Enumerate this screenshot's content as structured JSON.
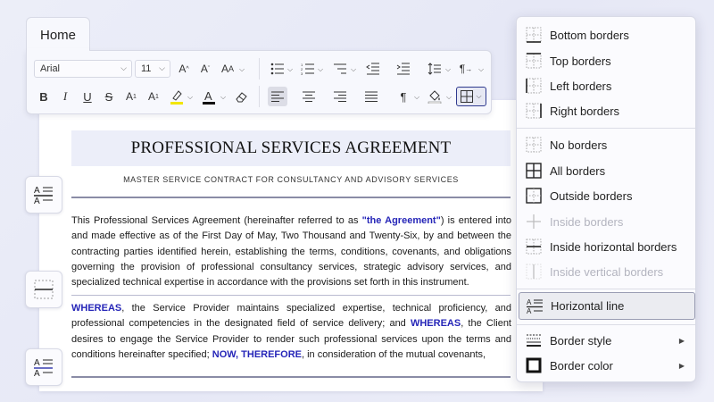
{
  "ribbon": {
    "tab_label": "Home",
    "font_family": "Arial",
    "font_size": "11"
  },
  "document": {
    "title": "PROFESSIONAL SERVICES AGREEMENT",
    "subtitle": "MASTER SERVICE CONTRACT FOR CONSULTANCY AND ADVISORY SERVICES",
    "para1": {
      "t1": "This Professional Services Agreement (hereinafter referred to as ",
      "t2": "\"the Agreement\"",
      "t3": ") is entered into and made effective as of the First Day of May, Two Thousand and Twenty-Six, by and between the contracting parties identified herein, establishing the terms, conditions, covenants, and obligations governing the provision of professional consultancy services, strategic advisory services, and specialized technical expertise in accordance with the provisions set forth in this instrument."
    },
    "para2": {
      "kw1": "WHEREAS",
      "t1": ", the Service Provider maintains specialized expertise, technical proficiency, and professional competencies in the designated field of service delivery; and ",
      "kw2": "WHEREAS",
      "t2": ", the Client desires to engage the Service Provider to render such professional services upon the terms and conditions hereinafter specified; ",
      "kw3": "NOW, THEREFORE",
      "t3": ", in consideration of the mutual covenants,"
    }
  },
  "border_menu": {
    "items": [
      {
        "label": "Bottom borders",
        "icon": "border-bottom-icon"
      },
      {
        "label": "Top borders",
        "icon": "border-top-icon"
      },
      {
        "label": "Left borders",
        "icon": "border-left-icon"
      },
      {
        "label": "Right borders",
        "icon": "border-right-icon"
      },
      {
        "label": "No borders",
        "icon": "border-none-icon"
      },
      {
        "label": "All borders",
        "icon": "border-all-icon"
      },
      {
        "label": "Outside borders",
        "icon": "border-outside-icon"
      },
      {
        "label": "Inside borders",
        "icon": "border-inside-icon",
        "disabled": true
      },
      {
        "label": "Inside horizontal borders",
        "icon": "border-inside-horizontal-icon"
      },
      {
        "label": "Inside vertical borders",
        "icon": "border-inside-vertical-icon",
        "disabled": true
      },
      {
        "label": "Horizontal line",
        "icon": "horizontal-line-icon",
        "active": true
      },
      {
        "label": "Border style",
        "icon": "border-style-icon",
        "submenu": true
      },
      {
        "label": "Border color",
        "icon": "border-color-icon",
        "submenu": true
      }
    ]
  },
  "colors": {
    "accent_blue": "#2626b8",
    "highlight_yellow": "#f2e600",
    "font_color_bar": "#111111"
  }
}
